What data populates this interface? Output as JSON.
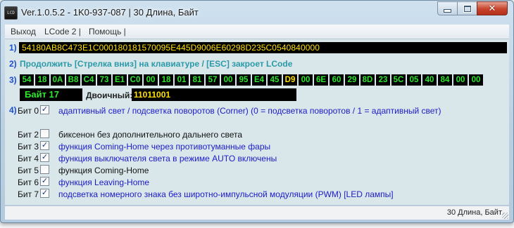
{
  "window": {
    "title": "Ver.1.0.5.2 -   1K0-937-087 | 30 Длина, Байт",
    "app_icon_text": "LCD"
  },
  "menu": [
    {
      "label": "Выход"
    },
    {
      "label": "LCode 2 |"
    },
    {
      "label": "Помощь |"
    }
  ],
  "rows": {
    "n1": "1)",
    "hex_string": "54180AB8C473E1C000180181570095E445D9006E60298D235C0540840000",
    "n2": "2)",
    "hint": "Продолжить [Стрелка вниз] на клавиатуре / [ESC] закроет LCode",
    "n3": "3)",
    "bytes": [
      "54",
      "18",
      "0A",
      "B8",
      "C4",
      "73",
      "E1",
      "C0",
      "00",
      "18",
      "01",
      "81",
      "57",
      "00",
      "95",
      "E4",
      "45",
      "D9",
      "00",
      "6E",
      "60",
      "29",
      "8D",
      "23",
      "5C",
      "05",
      "40",
      "84",
      "00",
      "00"
    ],
    "selected_byte_index": 17,
    "byte_label": "Байт 17",
    "binary_label": "Двоичный:",
    "binary_value": "11011001",
    "n4": "4)"
  },
  "bits": [
    {
      "label": "Бит 0",
      "checked": true,
      "text": "адаптивный свет / подсветка поворотов (Corner) (0 = подсветка поворотов / 1 = адаптивный свет)"
    },
    {
      "label": "Бит 2",
      "checked": false,
      "text": "биксенон без дополнительного дальнего света"
    },
    {
      "label": "Бит 3",
      "checked": true,
      "text": "функция Coming-Home через противотуманные фары"
    },
    {
      "label": "Бит 4",
      "checked": true,
      "text": "функция выключателя света в режиме AUTO включены"
    },
    {
      "label": "Бит 5",
      "checked": false,
      "text": "функция Coming-Home"
    },
    {
      "label": "Бит 6",
      "checked": true,
      "text": "функция Leaving-Home"
    },
    {
      "label": "Бит 7",
      "checked": true,
      "text": "подсветка номерного знака без широтно-импульсной модуляции (PWM) [LED лампы]"
    }
  ],
  "status": {
    "text": "30 Длина, Байт"
  },
  "colors": {
    "accent_number": "#1d4fd0",
    "hint": "#2a9aa8",
    "byte_text": "#2ee62e",
    "selected_byte_text": "#ffe000",
    "checked_text": "#1c1cc8"
  },
  "icons": {
    "check": "✓",
    "close": "✕"
  }
}
